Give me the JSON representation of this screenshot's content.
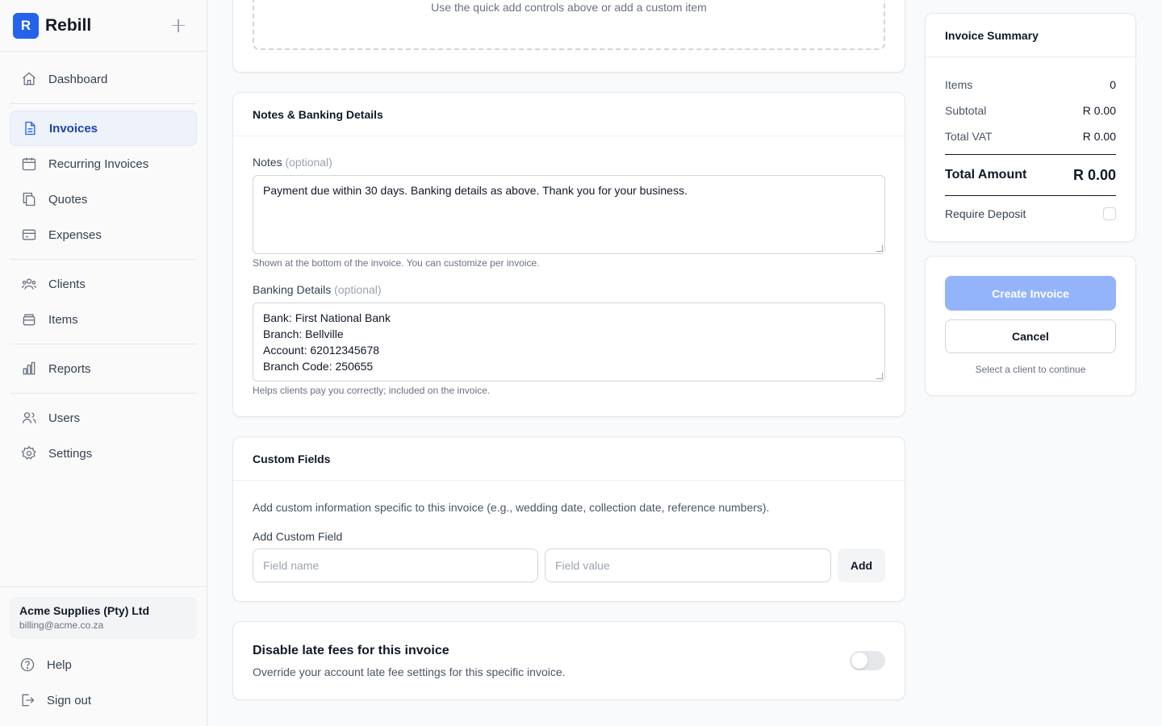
{
  "brand": {
    "logo_letter": "R",
    "name": "Rebill"
  },
  "sidebar": {
    "items": [
      {
        "label": "Dashboard",
        "icon": "home-icon"
      },
      {
        "label": "Invoices",
        "icon": "document-icon"
      },
      {
        "label": "Recurring Invoices",
        "icon": "calendar-icon"
      },
      {
        "label": "Quotes",
        "icon": "copy-icon"
      },
      {
        "label": "Expenses",
        "icon": "credit-card-icon"
      },
      {
        "label": "Clients",
        "icon": "users-group-icon"
      },
      {
        "label": "Items",
        "icon": "box-icon"
      },
      {
        "label": "Reports",
        "icon": "bar-chart-icon"
      },
      {
        "label": "Users",
        "icon": "users-icon"
      },
      {
        "label": "Settings",
        "icon": "gear-icon"
      }
    ],
    "active": "Invoices",
    "account": {
      "name": "Acme Supplies (Pty) Ltd",
      "email": "billing@acme.co.za"
    },
    "bottom": [
      {
        "label": "Help",
        "icon": "help-circle-icon"
      },
      {
        "label": "Sign out",
        "icon": "sign-out-icon"
      }
    ]
  },
  "items_section": {
    "empty_hint": "Use the quick add controls above or add a custom item"
  },
  "notes_section": {
    "title": "Notes & Banking Details",
    "notes_label": "Notes",
    "optional": "(optional)",
    "notes_value": "Payment due within 30 days. Banking details as above. Thank you for your business.",
    "notes_hint": "Shown at the bottom of the invoice. You can customize per invoice.",
    "banking_label": "Banking Details",
    "banking_value": "Bank: First National Bank\nBranch: Bellville\nAccount: 62012345678\nBranch Code: 250655",
    "banking_hint": "Helps clients pay you correctly; included on the invoice."
  },
  "custom_fields": {
    "title": "Custom Fields",
    "description": "Add custom information specific to this invoice (e.g., wedding date, collection date, reference numbers).",
    "add_label": "Add Custom Field",
    "name_placeholder": "Field name",
    "value_placeholder": "Field value",
    "add_button": "Add"
  },
  "late_fees": {
    "title": "Disable late fees for this invoice",
    "description": "Override your account late fee settings for this specific invoice.",
    "enabled": false
  },
  "summary": {
    "title": "Invoice Summary",
    "items_label": "Items",
    "items_value": "0",
    "subtotal_label": "Subtotal",
    "subtotal_value": "R 0.00",
    "vat_label": "Total VAT",
    "vat_value": "R 0.00",
    "total_label": "Total Amount",
    "total_value": "R 0.00",
    "deposit_label": "Require Deposit",
    "deposit_checked": false
  },
  "actions": {
    "create_label": "Create Invoice",
    "cancel_label": "Cancel",
    "hint": "Select a client to continue"
  },
  "colors": {
    "accent": "#2563eb",
    "primary_disabled": "#93b4fb"
  }
}
